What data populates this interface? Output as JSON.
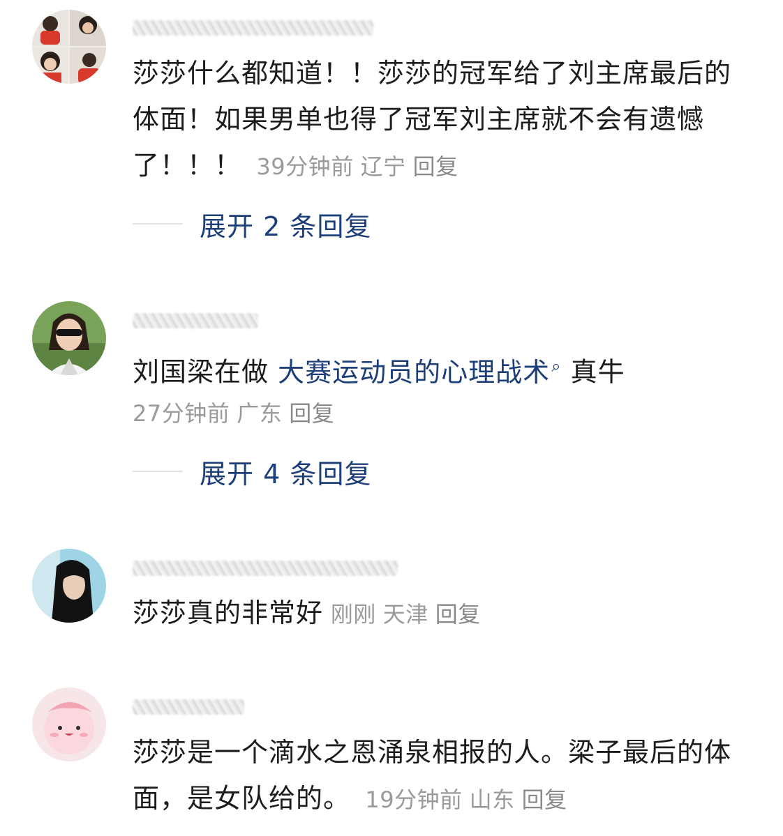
{
  "comments": [
    {
      "text": "莎莎什么都知道！！莎莎的冠军给了刘主席最后的体面！如果男单也得了冠军刘主席就不会有遗憾了！！！",
      "time": "39分钟前",
      "location": "辽宁",
      "reply_label": "回复",
      "expand_label": "展开 2 条回复"
    },
    {
      "text_before": "刘国梁在做",
      "link_text": "大赛运动员的心理战术",
      "link_icon": "search-icon",
      "text_after": "真牛",
      "time": "27分钟前",
      "location": "广东",
      "reply_label": "回复",
      "expand_label": "展开 4 条回复"
    },
    {
      "text": "莎莎真的非常好",
      "time": "刚刚",
      "location": "天津",
      "reply_label": "回复"
    },
    {
      "text": "莎莎是一个滴水之恩涌泉相报的人。梁子最后的体面，是女队给的。",
      "time": "19分钟前",
      "location": "山东",
      "reply_label": "回复"
    }
  ],
  "colors": {
    "link": "#1d3f79",
    "meta": "#9a9a9a",
    "text": "#1c1c1c"
  }
}
